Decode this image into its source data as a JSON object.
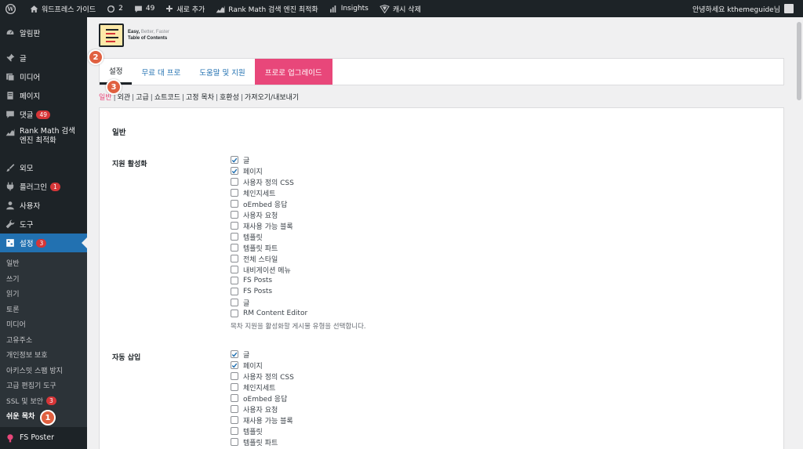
{
  "adminbar": {
    "site_name": "워드프레스 가이드",
    "updates_count": "2",
    "comments_count": "49",
    "new_label": "새로 추가",
    "rankmath_label": "Rank Math 검색 엔진 최적화",
    "insights_label": "Insights",
    "cache_label": "캐시 삭제",
    "greeting": "안녕하세요 kthemeguide님"
  },
  "sidebar": {
    "items": [
      {
        "label": "알림판",
        "icon": "dashboard-icon"
      },
      {
        "label": "글",
        "icon": "pin-icon"
      },
      {
        "label": "미디어",
        "icon": "media-icon"
      },
      {
        "label": "페이지",
        "icon": "page-icon"
      },
      {
        "label": "댓글",
        "icon": "comment-icon",
        "badge": "49"
      },
      {
        "label": "Rank Math 검색 엔진 최적화",
        "icon": "rankmath-icon"
      },
      {
        "label": "외모",
        "icon": "brush-icon"
      },
      {
        "label": "플러그인",
        "icon": "plugin-icon",
        "badge": "1"
      },
      {
        "label": "사용자",
        "icon": "user-icon"
      },
      {
        "label": "도구",
        "icon": "wrench-icon"
      },
      {
        "label": "설정",
        "icon": "settings-icon",
        "badge": "3"
      }
    ],
    "submenu": [
      {
        "label": "일반"
      },
      {
        "label": "쓰기"
      },
      {
        "label": "읽기"
      },
      {
        "label": "토론"
      },
      {
        "label": "미디어"
      },
      {
        "label": "고유주소"
      },
      {
        "label": "개인정보 보호"
      },
      {
        "label": "아키스밋 스팸 방지"
      },
      {
        "label": "고급 편집기 도구"
      },
      {
        "label": "SSL 및 보안",
        "badge": "3"
      },
      {
        "label": "쉬운 목차"
      }
    ],
    "fs_poster": "FS Poster"
  },
  "logo": {
    "line1a": "Easy,",
    "line1b": " Better, Faster",
    "line2": "Table of Contents"
  },
  "tabs": [
    {
      "label": "설정"
    },
    {
      "label": "무료 대 프로"
    },
    {
      "label": "도움말 및 지원"
    },
    {
      "label": "프로로 업그레이드"
    }
  ],
  "subnav": [
    "일반",
    "외관",
    "고급",
    "쇼트코드",
    "고정 목차",
    "호환성",
    "가져오기/내보내기"
  ],
  "steps": [
    "1",
    "2",
    "3"
  ],
  "panel": {
    "heading": "일반",
    "support": {
      "label": "지원 활성화",
      "options": [
        {
          "label": "글",
          "checked": true
        },
        {
          "label": "페이지",
          "checked": true
        },
        {
          "label": "사용자 정의 CSS",
          "checked": false
        },
        {
          "label": "체인지세트",
          "checked": false
        },
        {
          "label": "oEmbed 응답",
          "checked": false
        },
        {
          "label": "사용자 요청",
          "checked": false
        },
        {
          "label": "재사용 가능 블록",
          "checked": false
        },
        {
          "label": "템플릿",
          "checked": false
        },
        {
          "label": "템플릿 파트",
          "checked": false
        },
        {
          "label": "전체 스타일",
          "checked": false
        },
        {
          "label": "내비게이션 메뉴",
          "checked": false
        },
        {
          "label": "FS Posts",
          "checked": false
        },
        {
          "label": "FS Posts",
          "checked": false
        },
        {
          "label": "글",
          "checked": false
        },
        {
          "label": "RM Content Editor",
          "checked": false
        }
      ],
      "description": "목차 지원을 활성화할 게시물 유형을 선택합니다."
    },
    "autoinsert": {
      "label": "자동 삽입",
      "options": [
        {
          "label": "글",
          "checked": true
        },
        {
          "label": "페이지",
          "checked": true
        },
        {
          "label": "사용자 정의 CSS",
          "checked": false
        },
        {
          "label": "체인지세트",
          "checked": false
        },
        {
          "label": "oEmbed 응답",
          "checked": false
        },
        {
          "label": "사용자 요청",
          "checked": false
        },
        {
          "label": "재사용 가능 블록",
          "checked": false
        },
        {
          "label": "템플릿",
          "checked": false
        },
        {
          "label": "템플릿 파트",
          "checked": false
        },
        {
          "label": "",
          "checked": false
        }
      ]
    }
  },
  "colors": {
    "admin_dark": "#1d2327",
    "admin_blue": "#2271b1",
    "upgrade_pink": "#e8477a",
    "step_orange": "#e06040",
    "badge_red": "#d63638"
  }
}
